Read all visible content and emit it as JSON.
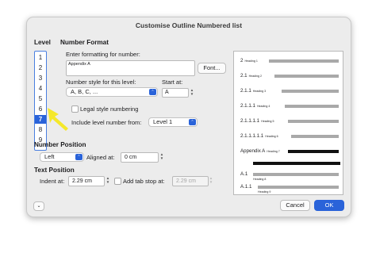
{
  "dialog": {
    "title": "Customise Outline Numbered list"
  },
  "level": {
    "label": "Level",
    "items": [
      "1",
      "2",
      "3",
      "4",
      "5",
      "6",
      "7",
      "8",
      "9"
    ],
    "selected": "7"
  },
  "number_format": {
    "section_label": "Number Format",
    "enter_label": "Enter formatting for number:",
    "format_value": "Appendix A",
    "font_button": "Font...",
    "style_label": "Number style for this level:",
    "style_value": "A, B, C, ...",
    "start_label": "Start at:",
    "start_value": "A",
    "legal_label": "Legal style numbering",
    "include_label": "Include level number from:",
    "include_value": "Level 1"
  },
  "number_position": {
    "section_label": "Number Position",
    "align_value": "Left",
    "aligned_at_label": "Aligned at:",
    "aligned_at_value": "0 cm"
  },
  "text_position": {
    "section_label": "Text Position",
    "indent_label": "Indent at:",
    "indent_value": "2.29 cm",
    "tab_stop_label": "Add tab stop at:",
    "tab_stop_value": "2.29 cm"
  },
  "preview": [
    {
      "num": "2",
      "heading": "Heading 1"
    },
    {
      "num": "2.1",
      "heading": "Heading 2"
    },
    {
      "num": "2.1.1",
      "heading": "Heading 3"
    },
    {
      "num": "2.1.1.1",
      "heading": "Heading 4"
    },
    {
      "num": "2.1.1.1.1",
      "heading": "Heading 5"
    },
    {
      "num": "2.1.1.1.1.1",
      "heading": "Heading 6"
    },
    {
      "num": "Appendix A",
      "heading": "Heading 7"
    },
    {
      "num": "A.1",
      "heading": "Heading 8"
    },
    {
      "num": "A.1.1",
      "heading": "Heading 9"
    }
  ],
  "buttons": {
    "cancel": "Cancel",
    "ok": "OK"
  },
  "colors": {
    "accent": "#2a63d9",
    "pointer": "#f5e82a"
  }
}
